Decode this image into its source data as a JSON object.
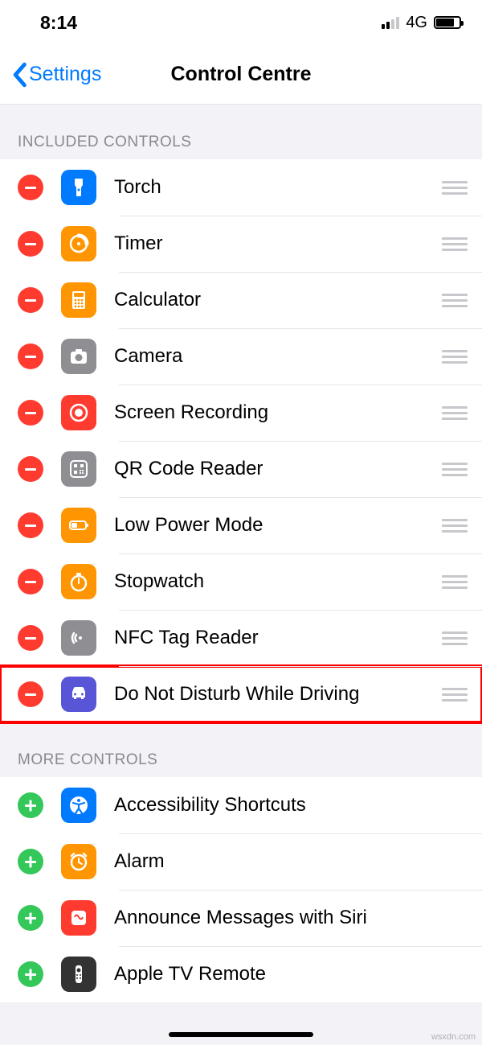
{
  "status": {
    "time": "8:14",
    "network": "4G"
  },
  "nav": {
    "back": "Settings",
    "title": "Control Centre"
  },
  "sections": {
    "included": {
      "header": "INCLUDED CONTROLS",
      "items": [
        {
          "id": "torch",
          "label": "Torch",
          "icon": "flashlight",
          "bg": "bg-blue"
        },
        {
          "id": "timer",
          "label": "Timer",
          "icon": "timer",
          "bg": "bg-orange"
        },
        {
          "id": "calculator",
          "label": "Calculator",
          "icon": "calculator",
          "bg": "bg-orange"
        },
        {
          "id": "camera",
          "label": "Camera",
          "icon": "camera",
          "bg": "bg-gray"
        },
        {
          "id": "screen-recording",
          "label": "Screen Recording",
          "icon": "record",
          "bg": "bg-red"
        },
        {
          "id": "qr",
          "label": "QR Code Reader",
          "icon": "qr",
          "bg": "bg-gray"
        },
        {
          "id": "low-power",
          "label": "Low Power Mode",
          "icon": "battery",
          "bg": "bg-orange"
        },
        {
          "id": "stopwatch",
          "label": "Stopwatch",
          "icon": "stopwatch",
          "bg": "bg-orange"
        },
        {
          "id": "nfc",
          "label": "NFC Tag Reader",
          "icon": "nfc",
          "bg": "bg-gray"
        },
        {
          "id": "dnd-driving",
          "label": "Do Not Disturb While Driving",
          "icon": "car",
          "bg": "bg-indigo",
          "highlight": true
        }
      ]
    },
    "more": {
      "header": "MORE CONTROLS",
      "items": [
        {
          "id": "accessibility",
          "label": "Accessibility Shortcuts",
          "icon": "accessibility",
          "bg": "bg-blue"
        },
        {
          "id": "alarm",
          "label": "Alarm",
          "icon": "alarm",
          "bg": "bg-orange"
        },
        {
          "id": "announce-siri",
          "label": "Announce Messages with Siri",
          "icon": "siri",
          "bg": "bg-red"
        },
        {
          "id": "apple-tv",
          "label": "Apple TV Remote",
          "icon": "tvremote",
          "bg": "bg-darkgray"
        }
      ]
    }
  },
  "watermark": "wsxdn.com"
}
